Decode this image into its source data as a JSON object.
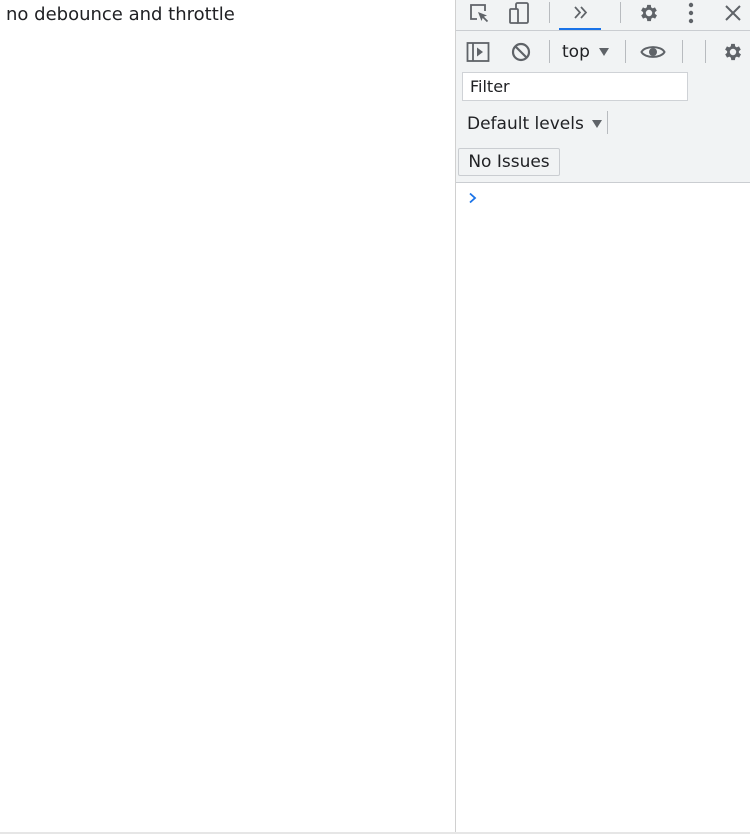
{
  "page": {
    "heading": "no debounce and throttle"
  },
  "devtools": {
    "toolbar": {
      "icons": [
        "inspect-element-icon",
        "device-toolbar-icon",
        "more-tabs-icon",
        "settings-icon",
        "kebab-menu-icon",
        "close-icon"
      ]
    },
    "console_toolbar": {
      "context": "top",
      "icons": [
        "sidebar-toggle-icon",
        "clear-console-icon",
        "eye-icon",
        "console-settings-icon"
      ]
    },
    "filter": {
      "placeholder": "Filter",
      "value": ""
    },
    "levels": {
      "label": "Default levels"
    },
    "issues": {
      "label": "No Issues"
    },
    "colors": {
      "accent": "#1a73e8",
      "prompt": "#1a73e8",
      "chrome_bg": "#f1f3f4",
      "icon": "#5f6368"
    }
  }
}
